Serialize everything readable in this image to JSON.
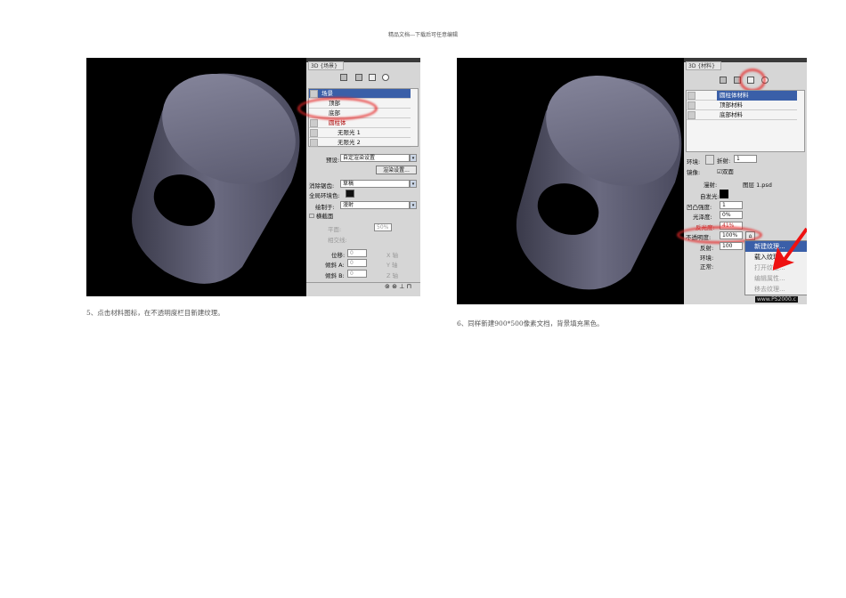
{
  "header": "精品文档---下载后可任意编辑",
  "left": {
    "caption": "5、点击材料图标，在不透明度栏目新建纹理。",
    "panel": {
      "title": "3D {场景}",
      "tree": [
        "场景",
        "顶部",
        "底部",
        "圆柱体",
        "无限光 1",
        "无限光 2"
      ],
      "preset_label": "预设:",
      "preset_value": "自定渲染设置",
      "render_button": "渲染设置...",
      "aa_label": "消除锯齿:",
      "aa_value": "草稿",
      "ambient_label": "全局环境色:",
      "draw_label": "绘制于:",
      "draw_value": "漫射",
      "cross_label": "横截面",
      "plane_label": "平面:",
      "plane_value": "50%",
      "intersect_label": "相交线:",
      "offset_label": "位移:",
      "offset_value": "0",
      "x_axis": "X 轴",
      "tiltA_label": "倾斜 A:",
      "tiltA_value": "0",
      "y_axis": "Y 轴",
      "tiltB_label": "倾斜 B:",
      "tiltB_value": "0",
      "z_axis": "Z 轴"
    }
  },
  "right": {
    "caption": "6、同样新建900*500像素文档，背景填充黑色。",
    "panel": {
      "title": "3D {材料}",
      "materials": [
        "圆柱体材料",
        "顶部材料",
        "底部材料"
      ],
      "env_label": "环境:",
      "refract_label": "折射:",
      "refract_value": "1",
      "mirror_label": "镜像:",
      "double_label": "双面",
      "diffuse_label": "漫射:",
      "diffuse_file": "图层 1.psd",
      "emissive_label": "自发光:",
      "bump_label": "凹凸强度:",
      "bump_value": "1",
      "gloss_label": "光泽度:",
      "gloss_value": "0%",
      "shine_label": "反光度:",
      "shine_value": "41%",
      "opacity_label": "不透明度:",
      "opacity_value": "100%",
      "reflect_label": "反射:",
      "reflect_value": "100",
      "env2_label": "环境:",
      "normal_label": "正常:",
      "menu": [
        "新建纹理...",
        "载入纹理...",
        "打开纹理...",
        "编辑属性...",
        "移去纹理..."
      ],
      "watermark": "www.PS2000.c"
    }
  }
}
